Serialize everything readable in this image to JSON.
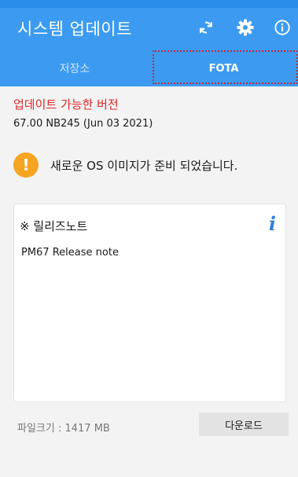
{
  "app": {
    "title": "시스템 업데이트"
  },
  "toolbar": {
    "icons": [
      "refresh-icon",
      "gear-icon",
      "info-icon"
    ],
    "accent_color": "#3c9bf1"
  },
  "tabs": [
    {
      "label": "저장소",
      "selected": false
    },
    {
      "label": "FOTA",
      "selected": true
    }
  ],
  "update": {
    "available_label": "업데이트 가능한 버전",
    "version": "67.00 NB245 (Jun 03 2021)",
    "notice_icon": "!",
    "notice": "새로운 OS 이미지가 준비 되었습니다.",
    "alert_color": "#e02727",
    "warning_color": "#f5a522"
  },
  "release_notes": {
    "header": "※ 릴리즈노트",
    "info_glyph": "i",
    "body": "PM67 Release note"
  },
  "footer": {
    "file_size": "파일크기 : 1417 MB",
    "download_label": "다운로드"
  }
}
